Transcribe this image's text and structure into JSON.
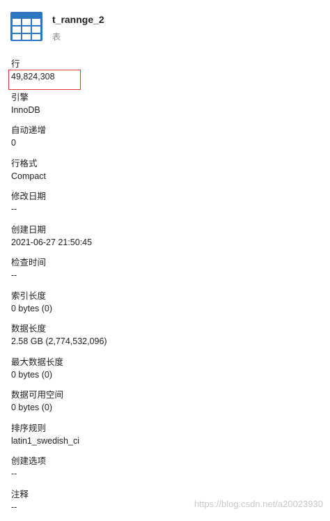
{
  "header": {
    "title": "t_rannge_2",
    "subtitle": "表",
    "icon": "table-grid-icon"
  },
  "properties": [
    {
      "label": "行",
      "value": "49,824,308"
    },
    {
      "label": "引擎",
      "value": "InnoDB"
    },
    {
      "label": "自动递增",
      "value": "0"
    },
    {
      "label": "行格式",
      "value": "Compact"
    },
    {
      "label": "修改日期",
      "value": "--"
    },
    {
      "label": "创建日期",
      "value": "2021-06-27 21:50:45"
    },
    {
      "label": "检查时间",
      "value": "--"
    },
    {
      "label": "索引长度",
      "value": "0 bytes (0)"
    },
    {
      "label": "数据长度",
      "value": "2.58 GB (2,774,532,096)"
    },
    {
      "label": "最大数据长度",
      "value": "0 bytes (0)"
    },
    {
      "label": "数据可用空间",
      "value": "0 bytes (0)"
    },
    {
      "label": "排序规则",
      "value": "latin1_swedish_ci"
    },
    {
      "label": "创建选项",
      "value": "--"
    },
    {
      "label": "注释",
      "value": "--"
    }
  ],
  "watermark": "https://blog.csdn.net/a20023930",
  "colors": {
    "icon_blue": "#2f76c2",
    "highlight_red": "#e53935"
  }
}
